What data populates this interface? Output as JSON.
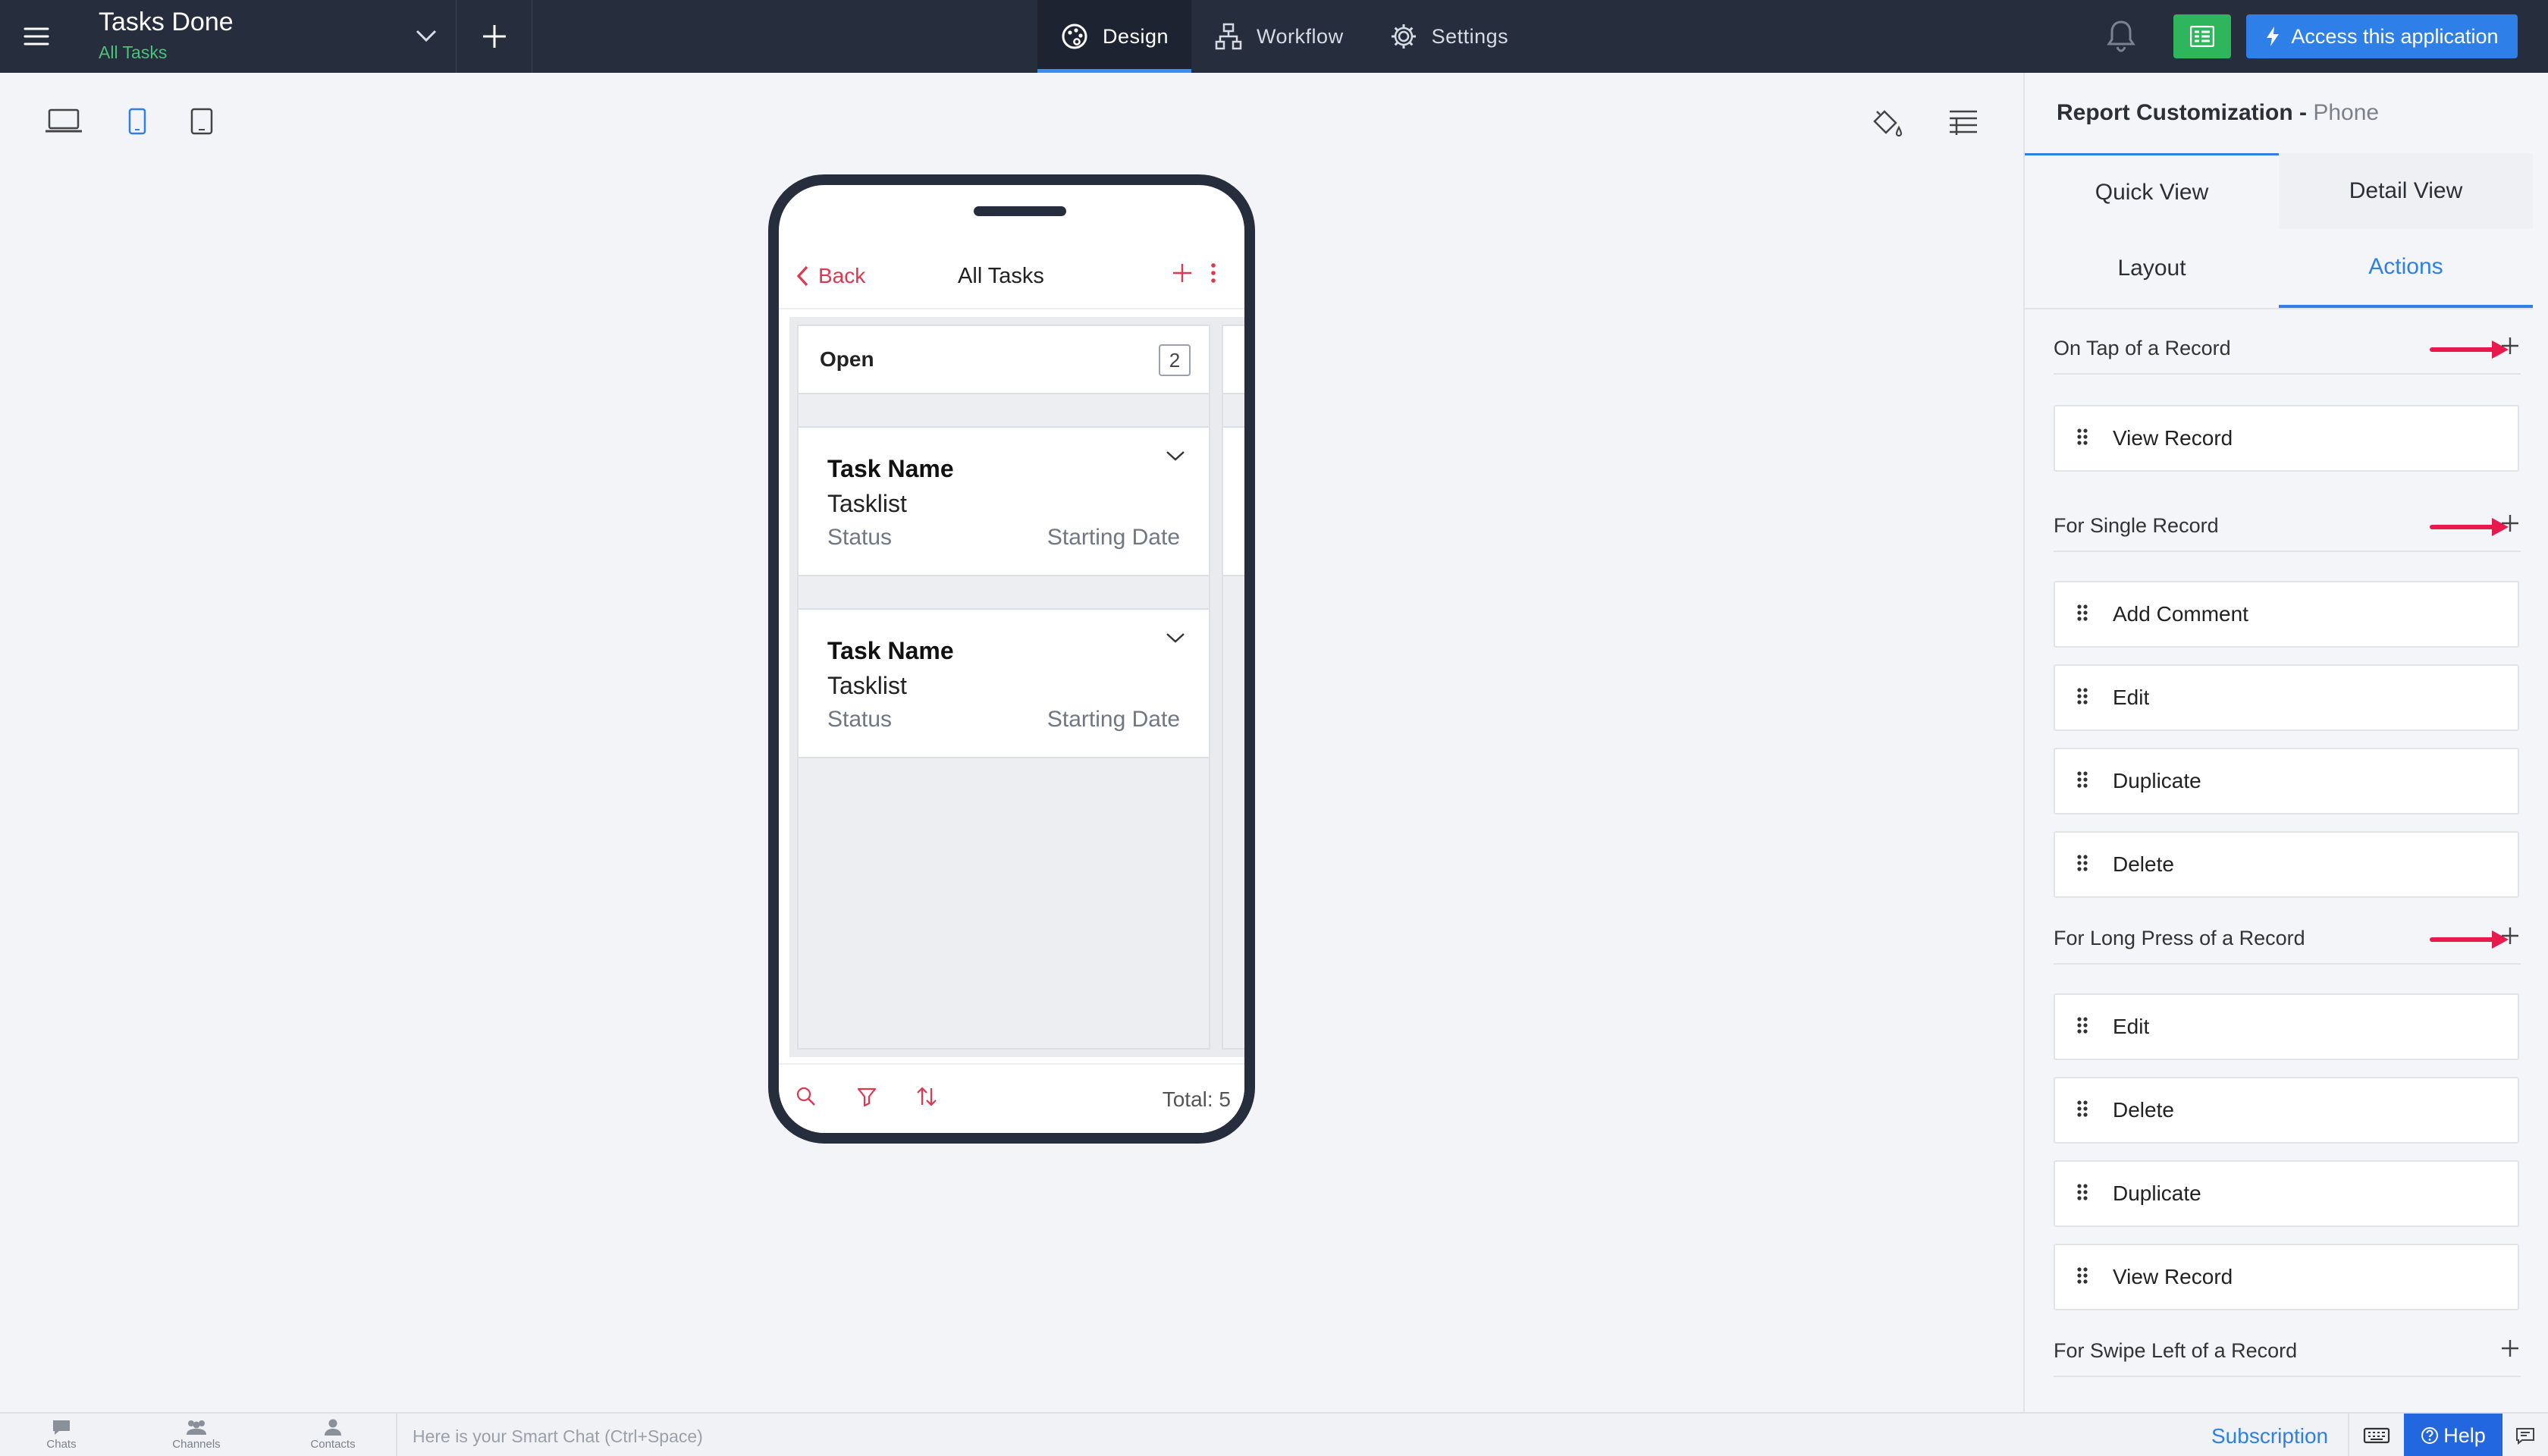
{
  "app": {
    "name": "Tasks Done",
    "subtitle": "All Tasks"
  },
  "top_tabs": [
    {
      "label": "Design",
      "icon": "palette-icon",
      "active": true
    },
    {
      "label": "Workflow",
      "icon": "workflow-icon",
      "active": false
    },
    {
      "label": "Settings",
      "icon": "gear-icon",
      "active": false
    }
  ],
  "access_button": "Access this application",
  "colors": {
    "accent": "#2e7fe8",
    "topbar": "#262d3c",
    "phone_red": "#e0364f",
    "green": "#2fb55b",
    "arrow": "#e8194d"
  },
  "phone": {
    "back": "Back",
    "title": "All Tasks",
    "column": {
      "name": "Open",
      "count": "2"
    },
    "cards": [
      {
        "title": "Task Name",
        "list": "Tasklist",
        "status": "Status",
        "date": "Starting Date"
      },
      {
        "title": "Task Name",
        "list": "Tasklist",
        "status": "Status",
        "date": "Starting Date"
      }
    ],
    "total": "Total: 5"
  },
  "panel": {
    "title": "Report Customization",
    "device": "Phone",
    "view_tabs": [
      "Quick View",
      "Detail View"
    ],
    "sub_tabs": [
      "Layout",
      "Actions"
    ],
    "sections": [
      {
        "label": "On Tap of a Record",
        "items": [
          "View Record"
        ]
      },
      {
        "label": "For Single Record",
        "items": [
          "Add Comment",
          "Edit",
          "Duplicate",
          "Delete"
        ]
      },
      {
        "label": "For Long Press of a Record",
        "items": [
          "Edit",
          "Delete",
          "Duplicate",
          "View Record"
        ]
      },
      {
        "label": "For Swipe Left of a Record",
        "items": []
      }
    ]
  },
  "statusbar": {
    "chats": "Chats",
    "channels": "Channels",
    "contacts": "Contacts",
    "chat_placeholder": "Here is your Smart Chat (Ctrl+Space)",
    "subscription": "Subscription",
    "help": "Help"
  }
}
